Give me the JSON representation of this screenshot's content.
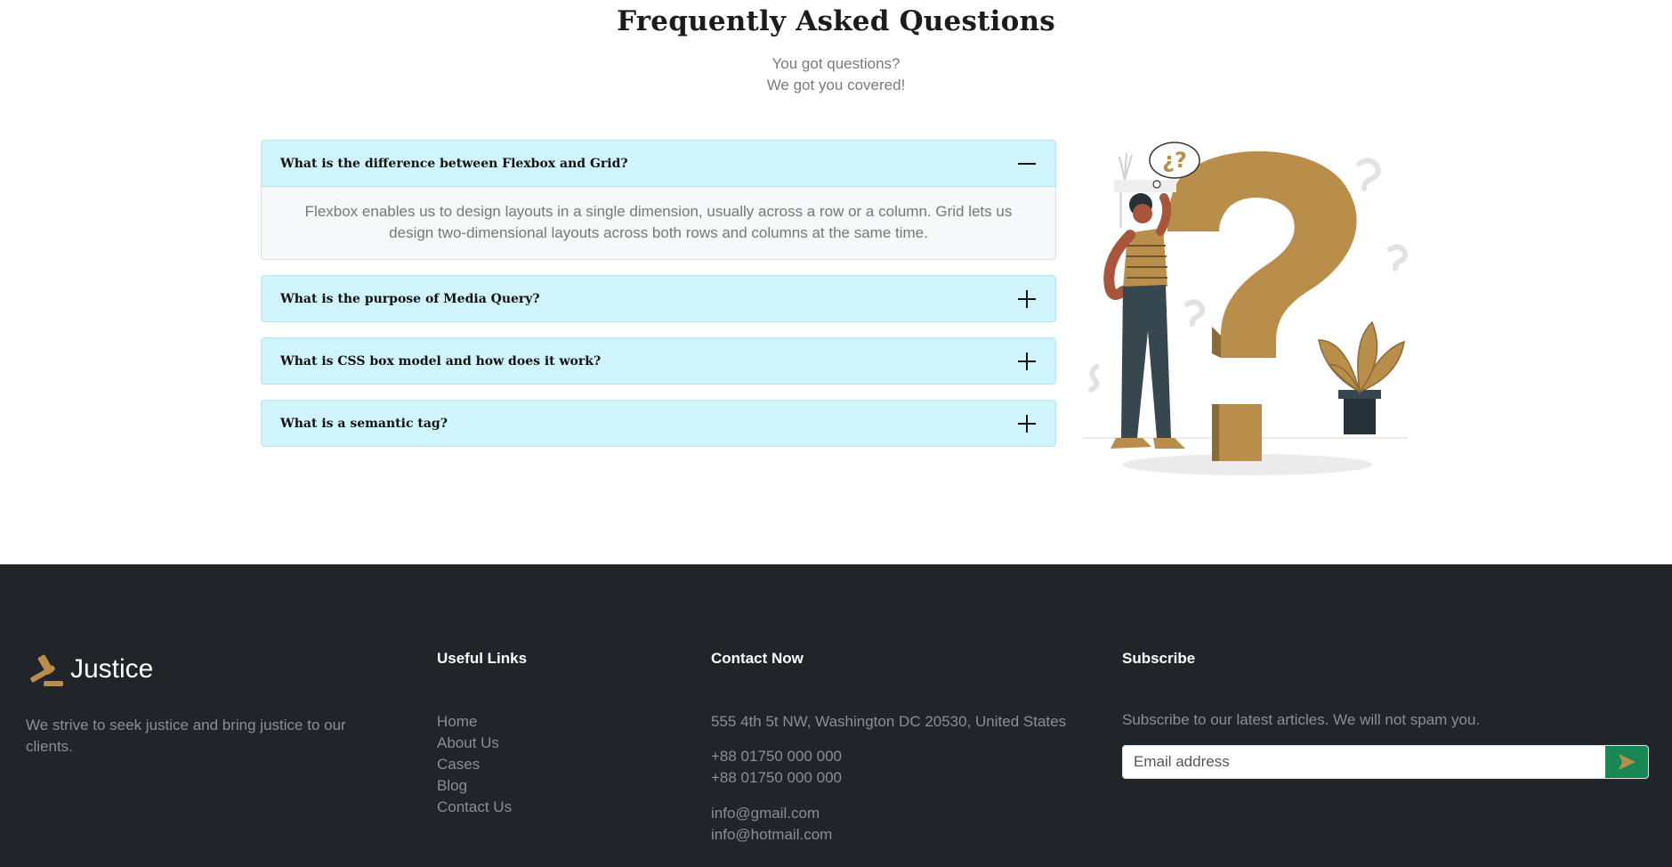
{
  "faq": {
    "title": "Frequently Asked Questions",
    "subtitle_line1": "You got questions?",
    "subtitle_line2": "We got you covered!",
    "items": [
      {
        "question": "What is the difference between Flexbox and Grid?",
        "answer": "Flexbox enables us to design layouts in a single dimension, usually across a row or a column. Grid lets us design two-dimensional layouts across both rows and columns at the same time.",
        "expanded": true
      },
      {
        "question": "What is the purpose of Media Query?",
        "expanded": false
      },
      {
        "question": "What is CSS box model and how does it work?",
        "expanded": false
      },
      {
        "question": "What is a semantic tag?",
        "expanded": false
      }
    ],
    "illustration_text": "¿?"
  },
  "footer": {
    "brand": {
      "name": "Justice",
      "description": "We strive to seek justice and bring justice to our clients.",
      "icon": "gavel-icon"
    },
    "useful_links": {
      "title": "Useful Links",
      "items": [
        "Home",
        "About Us",
        "Cases",
        "Blog",
        "Contact Us"
      ]
    },
    "contact": {
      "title": "Contact Now",
      "address": "555 4th 5t NW, Washington DC 20530, United States",
      "phones": [
        "+88 01750 000 000",
        "+88 01750 000 000"
      ],
      "emails": [
        "info@gmail.com",
        "info@hotmail.com"
      ]
    },
    "subscribe": {
      "title": "Subscribe",
      "description": "Subscribe to our latest articles. We will not spam you.",
      "placeholder": "Email address",
      "button_icon": "send-icon"
    }
  },
  "colors": {
    "accordion_header": "#cff4fc",
    "footer_bg": "#212529",
    "accent_gold": "#b98e4b",
    "button_green": "#198754"
  }
}
